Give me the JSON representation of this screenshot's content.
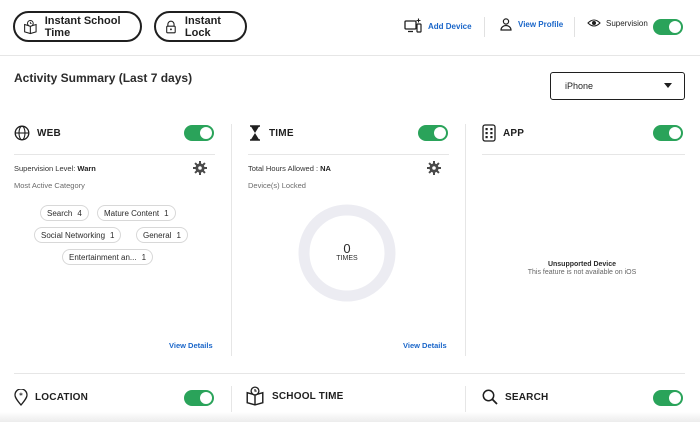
{
  "topbar": {
    "instant_school_time": "Instant School Time",
    "instant_lock": "Instant Lock",
    "add_device": "Add Device",
    "view_profile": "View Profile",
    "supervision": "Supervision"
  },
  "summary": {
    "title": "Activity Summary  (Last 7 days)",
    "device_selected": "iPhone"
  },
  "web": {
    "title": "WEB",
    "supervision_label": "Supervision Level:",
    "supervision_value": "Warn",
    "most_active": "Most Active Category",
    "categories": [
      {
        "name": "Search",
        "count": "4"
      },
      {
        "name": "Mature Content",
        "count": "1"
      },
      {
        "name": "Social Networking",
        "count": "1"
      },
      {
        "name": "General",
        "count": "1"
      },
      {
        "name": "Entertainment an...",
        "count": "1"
      }
    ],
    "view_details": "View Details"
  },
  "time": {
    "title": "TIME",
    "total_hours_label": "Total Hours Allowed :",
    "total_hours_value": "NA",
    "devices_locked": "Device(s) Locked",
    "ring_value": "0",
    "ring_unit": "TIMES",
    "view_details": "View Details"
  },
  "app": {
    "title": "APP",
    "unsupported_title": "Unsupported Device",
    "unsupported_sub": "This feature is not available on iOS"
  },
  "bottom_cards": {
    "location": "LOCATION",
    "school_time": "SCHOOL TIME",
    "search": "SEARCH"
  },
  "colors": {
    "accent_blue": "#1a66c9",
    "toggle_green": "#2aa35a",
    "ring_gray": "#ececf2"
  },
  "icons": {
    "school": "book-clock-icon",
    "lock": "padlock-icon",
    "add_device": "device-add-icon",
    "profile": "person-icon",
    "supervision": "eye-icon",
    "web": "globe-icon",
    "time": "hourglass-icon",
    "app": "app-grid-icon",
    "location": "location-pin-icon",
    "school_time": "book-clock-icon",
    "search": "search-icon",
    "settings": "gear-icon"
  }
}
